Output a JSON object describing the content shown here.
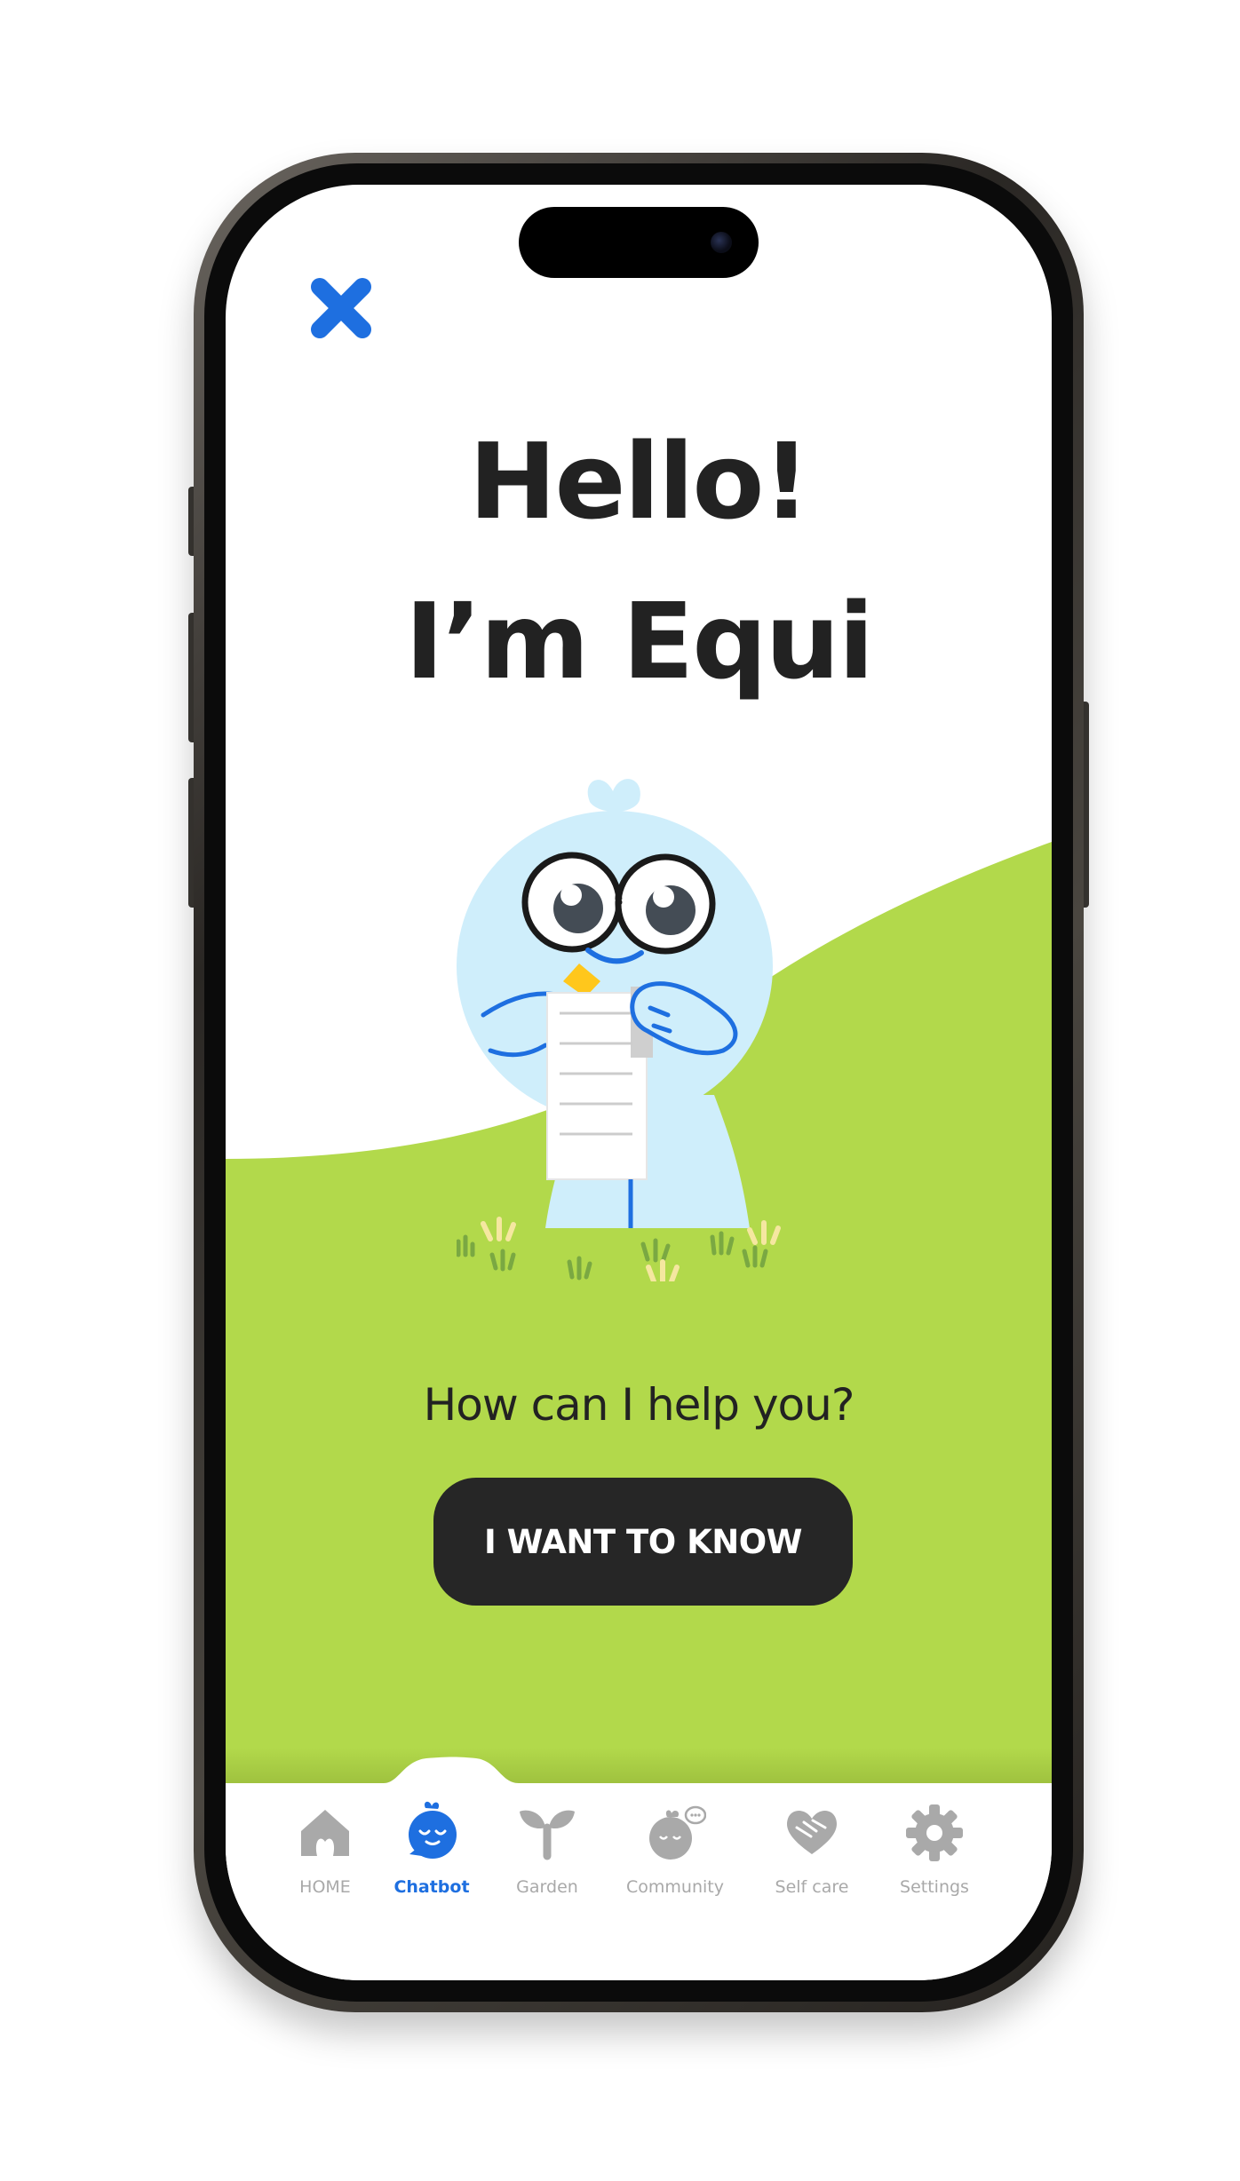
{
  "header": {
    "close_icon": "close-icon",
    "accent_color": "#1e6fe0"
  },
  "hero": {
    "title_line_1": "Hello!",
    "title_line_2": "I’m Equi"
  },
  "main": {
    "prompt": "How can I help you?",
    "cta_label": "I WANT TO KNOW",
    "background_color": "#b2d94b",
    "cta_color": "#262626"
  },
  "tabbar": {
    "active_tab": "Chatbot",
    "tabs": [
      {
        "label": "HOME",
        "icon": "home-icon"
      },
      {
        "label": "Chatbot",
        "icon": "chatbot-icon"
      },
      {
        "label": "Garden",
        "icon": "sprout-icon"
      },
      {
        "label": "Community",
        "icon": "community-icon"
      },
      {
        "label": "Self care",
        "icon": "heart-hands-icon"
      },
      {
        "label": "Settings",
        "icon": "gear-icon"
      }
    ]
  }
}
